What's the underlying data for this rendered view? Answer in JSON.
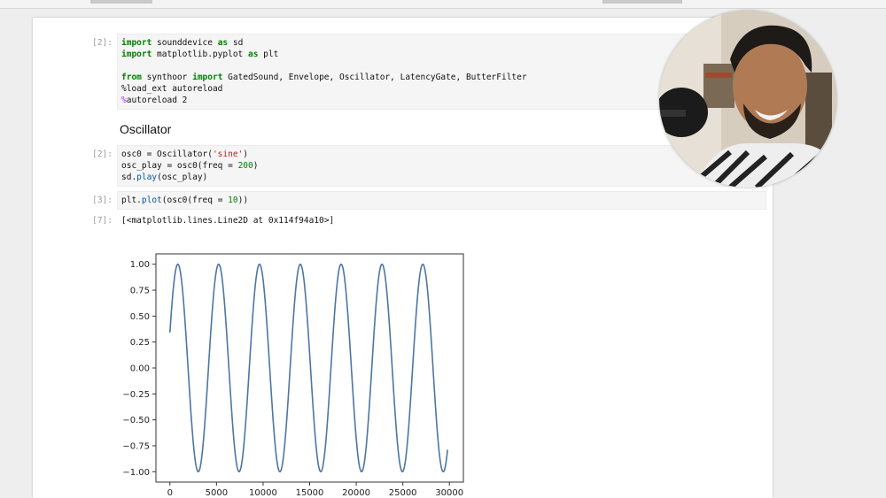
{
  "cells": [
    {
      "prompt": "[2]:",
      "lines": [
        [
          {
            "t": "import",
            "c": "kw"
          },
          {
            "t": " sounddevice "
          },
          {
            "t": "as",
            "c": "kw"
          },
          {
            "t": " sd"
          }
        ],
        [
          {
            "t": "import",
            "c": "kw"
          },
          {
            "t": " matplotlib.pyplot "
          },
          {
            "t": "as",
            "c": "kw"
          },
          {
            "t": " plt"
          }
        ],
        [],
        [
          {
            "t": "from",
            "c": "kw"
          },
          {
            "t": " synthoor "
          },
          {
            "t": "import",
            "c": "kw"
          },
          {
            "t": " GatedSound, Envelope, Oscillator, LatencyGate, ButterFilter"
          }
        ],
        [
          {
            "t": "%load_ext autoreload"
          }
        ],
        [
          {
            "t": "%",
            "c": "mag"
          },
          {
            "t": "autoreload 2"
          }
        ]
      ]
    },
    {
      "prompt": "[2]:",
      "lines": [
        [
          {
            "t": "osc0 = Oscillator("
          },
          {
            "t": "'sine'",
            "c": "str"
          },
          {
            "t": ")"
          }
        ],
        [
          {
            "t": "osc_play = osc0(freq = "
          },
          {
            "t": "200",
            "c": "num"
          },
          {
            "t": ")"
          }
        ],
        [
          {
            "t": "sd."
          },
          {
            "t": "play",
            "c": "fn"
          },
          {
            "t": "(osc_play)"
          }
        ]
      ]
    },
    {
      "prompt": "[3]:",
      "lines": [
        [
          {
            "t": "plt."
          },
          {
            "t": "plot",
            "c": "fn"
          },
          {
            "t": "(osc0(freq = "
          },
          {
            "t": "10",
            "c": "num"
          },
          {
            "t": "))"
          }
        ]
      ]
    }
  ],
  "heading": "Oscillator",
  "output": {
    "prompt": "[7]:",
    "text": "[<matplotlib.lines.Line2D at 0x114f94a10>]"
  },
  "chart_data": {
    "type": "line",
    "title": "",
    "xlabel": "",
    "ylabel": "",
    "xlim": [
      -1500,
      31500
    ],
    "ylim": [
      -1.1,
      1.1
    ],
    "xticks": [
      0,
      5000,
      10000,
      15000,
      20000,
      25000,
      30000
    ],
    "yticks": [
      1.0,
      0.75,
      0.5,
      0.25,
      0.0,
      -0.25,
      -0.5,
      -0.75,
      -1.0
    ],
    "ytick_labels": [
      "1.00",
      "0.75",
      "0.50",
      "0.25",
      "0.00",
      "−0.25",
      "−0.50",
      "−0.75",
      "−1.00"
    ],
    "grid": false,
    "series": [
      {
        "color": "#4c76a3",
        "function": "sine",
        "cycles": 6.8,
        "phase_deg": 20,
        "x_start": 0,
        "x_end": 29800,
        "amplitude": 1.0
      }
    ]
  },
  "webcam": {
    "description_icon": "webcam-presenter"
  }
}
